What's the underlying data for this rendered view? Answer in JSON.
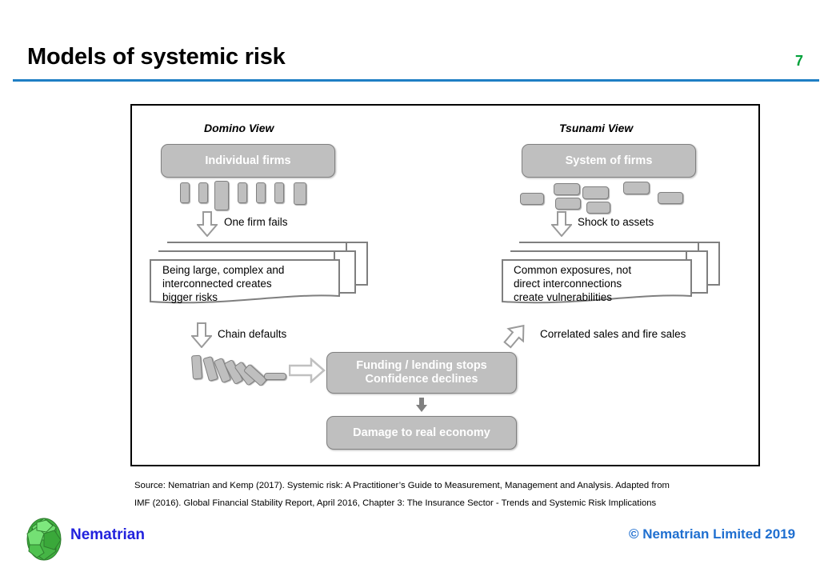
{
  "slide": {
    "title": "Models of systemic risk",
    "page_number": "7",
    "accent_rule_color": "#1f7fc4",
    "page_number_color": "#00a13a"
  },
  "diagram": {
    "columns": [
      {
        "heading": "Domino View"
      },
      {
        "heading": "Tsunami View"
      }
    ],
    "domino": {
      "top_box_label": "Individual  firms",
      "shock_caption": "One firm fails",
      "document_text": "Being large, complex and\ninterconnected creates\nbigger risks",
      "outcome_caption": "Chain defaults"
    },
    "tsunami": {
      "top_box_label": "System of firms",
      "shock_caption": "Shock to assets",
      "document_text": "Common exposures,  not\ndirect interconnections\ncreate vulnerabilities",
      "outcome_caption": "Correlated sales and fire sales"
    },
    "outcomes": {
      "funding_box_line1": "Funding / lending stops",
      "funding_box_line2": "Confidence declines",
      "damage_box_label": "Damage to real economy"
    },
    "box_fill_color": "#bfbfbf",
    "box_text_color": "#ffffff"
  },
  "source_note": {
    "line1": "Source: Nematrian and Kemp (2017).   Systemic risk: A Practitioner’s Guide to Measurement,  Management and Analysis. Adapted from",
    "line2": "IMF (2016). Global Financial Stability Report,  April 2016, Chapter  3: The Insurance  Sector - Trends  and Systemic Risk Implications"
  },
  "footer": {
    "brand": "Nematrian",
    "copyright": "© Nematrian Limited 2019",
    "brand_color": "#2222dd",
    "copyright_color": "#1f6fd0"
  }
}
